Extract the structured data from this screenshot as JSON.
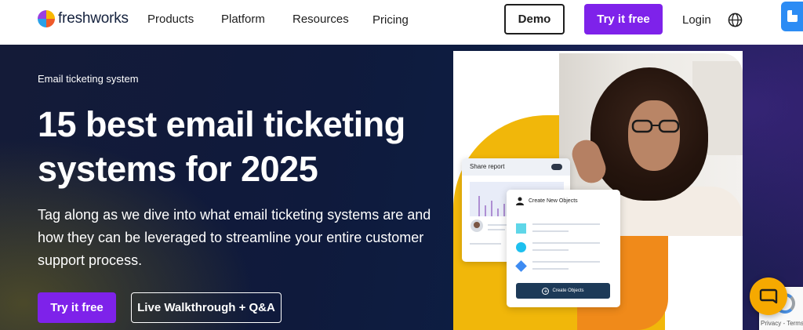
{
  "header": {
    "logo_text": "freshworks",
    "nav": [
      {
        "label": "Products"
      },
      {
        "label": "Platform"
      },
      {
        "label": "Resources"
      },
      {
        "label": "Pricing"
      }
    ],
    "demo_label": "Demo",
    "try_label": "Try it free",
    "login_label": "Login",
    "globe_icon": "globe-icon"
  },
  "hero": {
    "eyebrow": "Email ticketing system",
    "headline": "15 best email ticketing systems for 2025",
    "subtext": "Tag along as we dive into what email ticketing systems are and how they can be leveraged to streamline your entire customer support process.",
    "try_label": "Try it free",
    "walkthrough_label": "Live Walkthrough + Q&A"
  },
  "illustration": {
    "report_title": "Share report",
    "create_title": "Create New Objects",
    "create_button": "Create Objects"
  },
  "widgets": {
    "recaptcha_text": "Privacy - Terms"
  },
  "colors": {
    "brand_purple": "#7e22ea",
    "hero_bg": "#0f1a3c",
    "yellow": "#f1b70a",
    "orange": "#f08a1a",
    "chat_button": "#f6a900",
    "create_button": "#1d3a58"
  }
}
